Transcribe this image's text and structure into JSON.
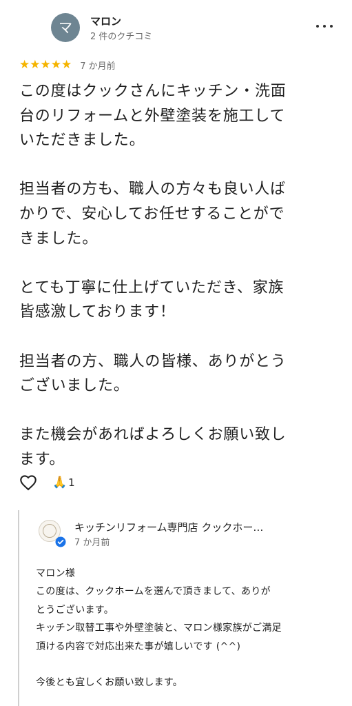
{
  "review": {
    "avatar_initial": "マ",
    "avatar_color": "#6e8592",
    "reviewer_name": "マロン",
    "reviewer_meta": "2 件のクチコミ",
    "stars": "★★★★★",
    "rating": 5,
    "star_color": "#f5b400",
    "date": "7 か月前",
    "text": "この度はクックさんにキッチン・洗面\n台のリフォームと外壁塗装を施工して\nいただきました。\n\n担当者の方も、職人の方々も良い人ば\nかりで、安心してお任せすることがで\nきました。\n\nとても丁寧に仕上げていただき、家族\n皆感激しております！\n\n担当者の方、職人の皆様、ありがとう\nございました。\n\nまた機会があればよろしくお願い致し\nます。",
    "more_icon": "more-vert-icon"
  },
  "actions": {
    "like_icon": "heart-outline-icon",
    "reaction_emoji": "🙏",
    "reaction_count": "1"
  },
  "owner_reply": {
    "name": "キッチンリフォーム専門店 クックホー…",
    "date": "7 か月前",
    "verified_icon": "verified-badge-icon",
    "verified_color": "#1a73e8",
    "text": "マロン様\nこの度は、クックホームを選んで頂きまして、ありが\nとうございます。\nキッチン取替工事や外壁塗装と、マロン様家族がご満足\n頂ける内容で対応出来た事が嬉しいです (^^)\n\n今後とも宜しくお願い致します。"
  }
}
